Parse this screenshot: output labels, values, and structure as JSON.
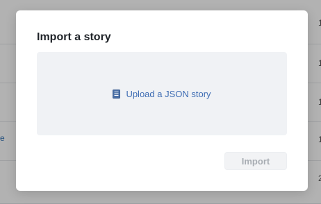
{
  "background": {
    "link_text": "e",
    "edge_marks": [
      "1",
      "1",
      "1",
      "1",
      "2"
    ]
  },
  "modal": {
    "title": "Import a story",
    "dropzone": {
      "icon": "book-icon",
      "upload_label": "Upload a JSON story"
    },
    "import_button_label": "Import",
    "import_button_state": "disabled"
  },
  "colors": {
    "accent": "#3d6cb3",
    "dropzone_bg": "#f0f2f5",
    "overlay": "rgba(0,0,0,0.30)"
  }
}
